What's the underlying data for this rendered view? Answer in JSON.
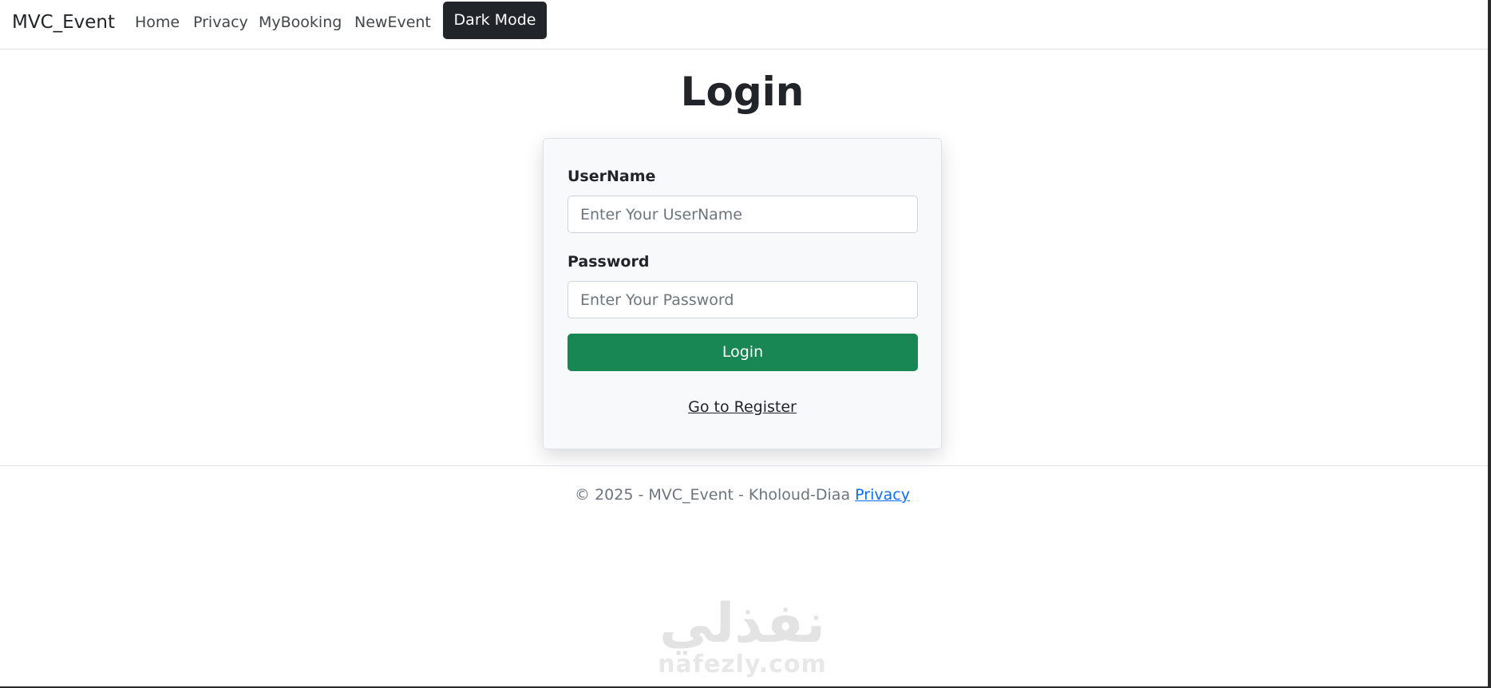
{
  "navbar": {
    "brand": "MVC_Event",
    "links": [
      "Home",
      "Privacy",
      "MyBooking",
      "NewEvent"
    ],
    "dark_mode_label": "Dark Mode"
  },
  "main": {
    "title": "Login",
    "form": {
      "username_label": "UserName",
      "username_placeholder": "Enter Your UserName",
      "username_value": "",
      "password_label": "Password",
      "password_placeholder": "Enter Your Password",
      "password_value": "",
      "submit_label": "Login",
      "register_link": "Go to Register"
    }
  },
  "footer": {
    "text": "© 2025 - MVC_Event - Kholoud-Diaa",
    "privacy_link": "Privacy"
  },
  "watermark": {
    "arabic": "نفذلي",
    "latin": "nafezly.com"
  },
  "colors": {
    "primary_button": "#198754",
    "dark_button": "#212529",
    "link": "#0d6efd",
    "card_background": "#f8f9fa"
  }
}
